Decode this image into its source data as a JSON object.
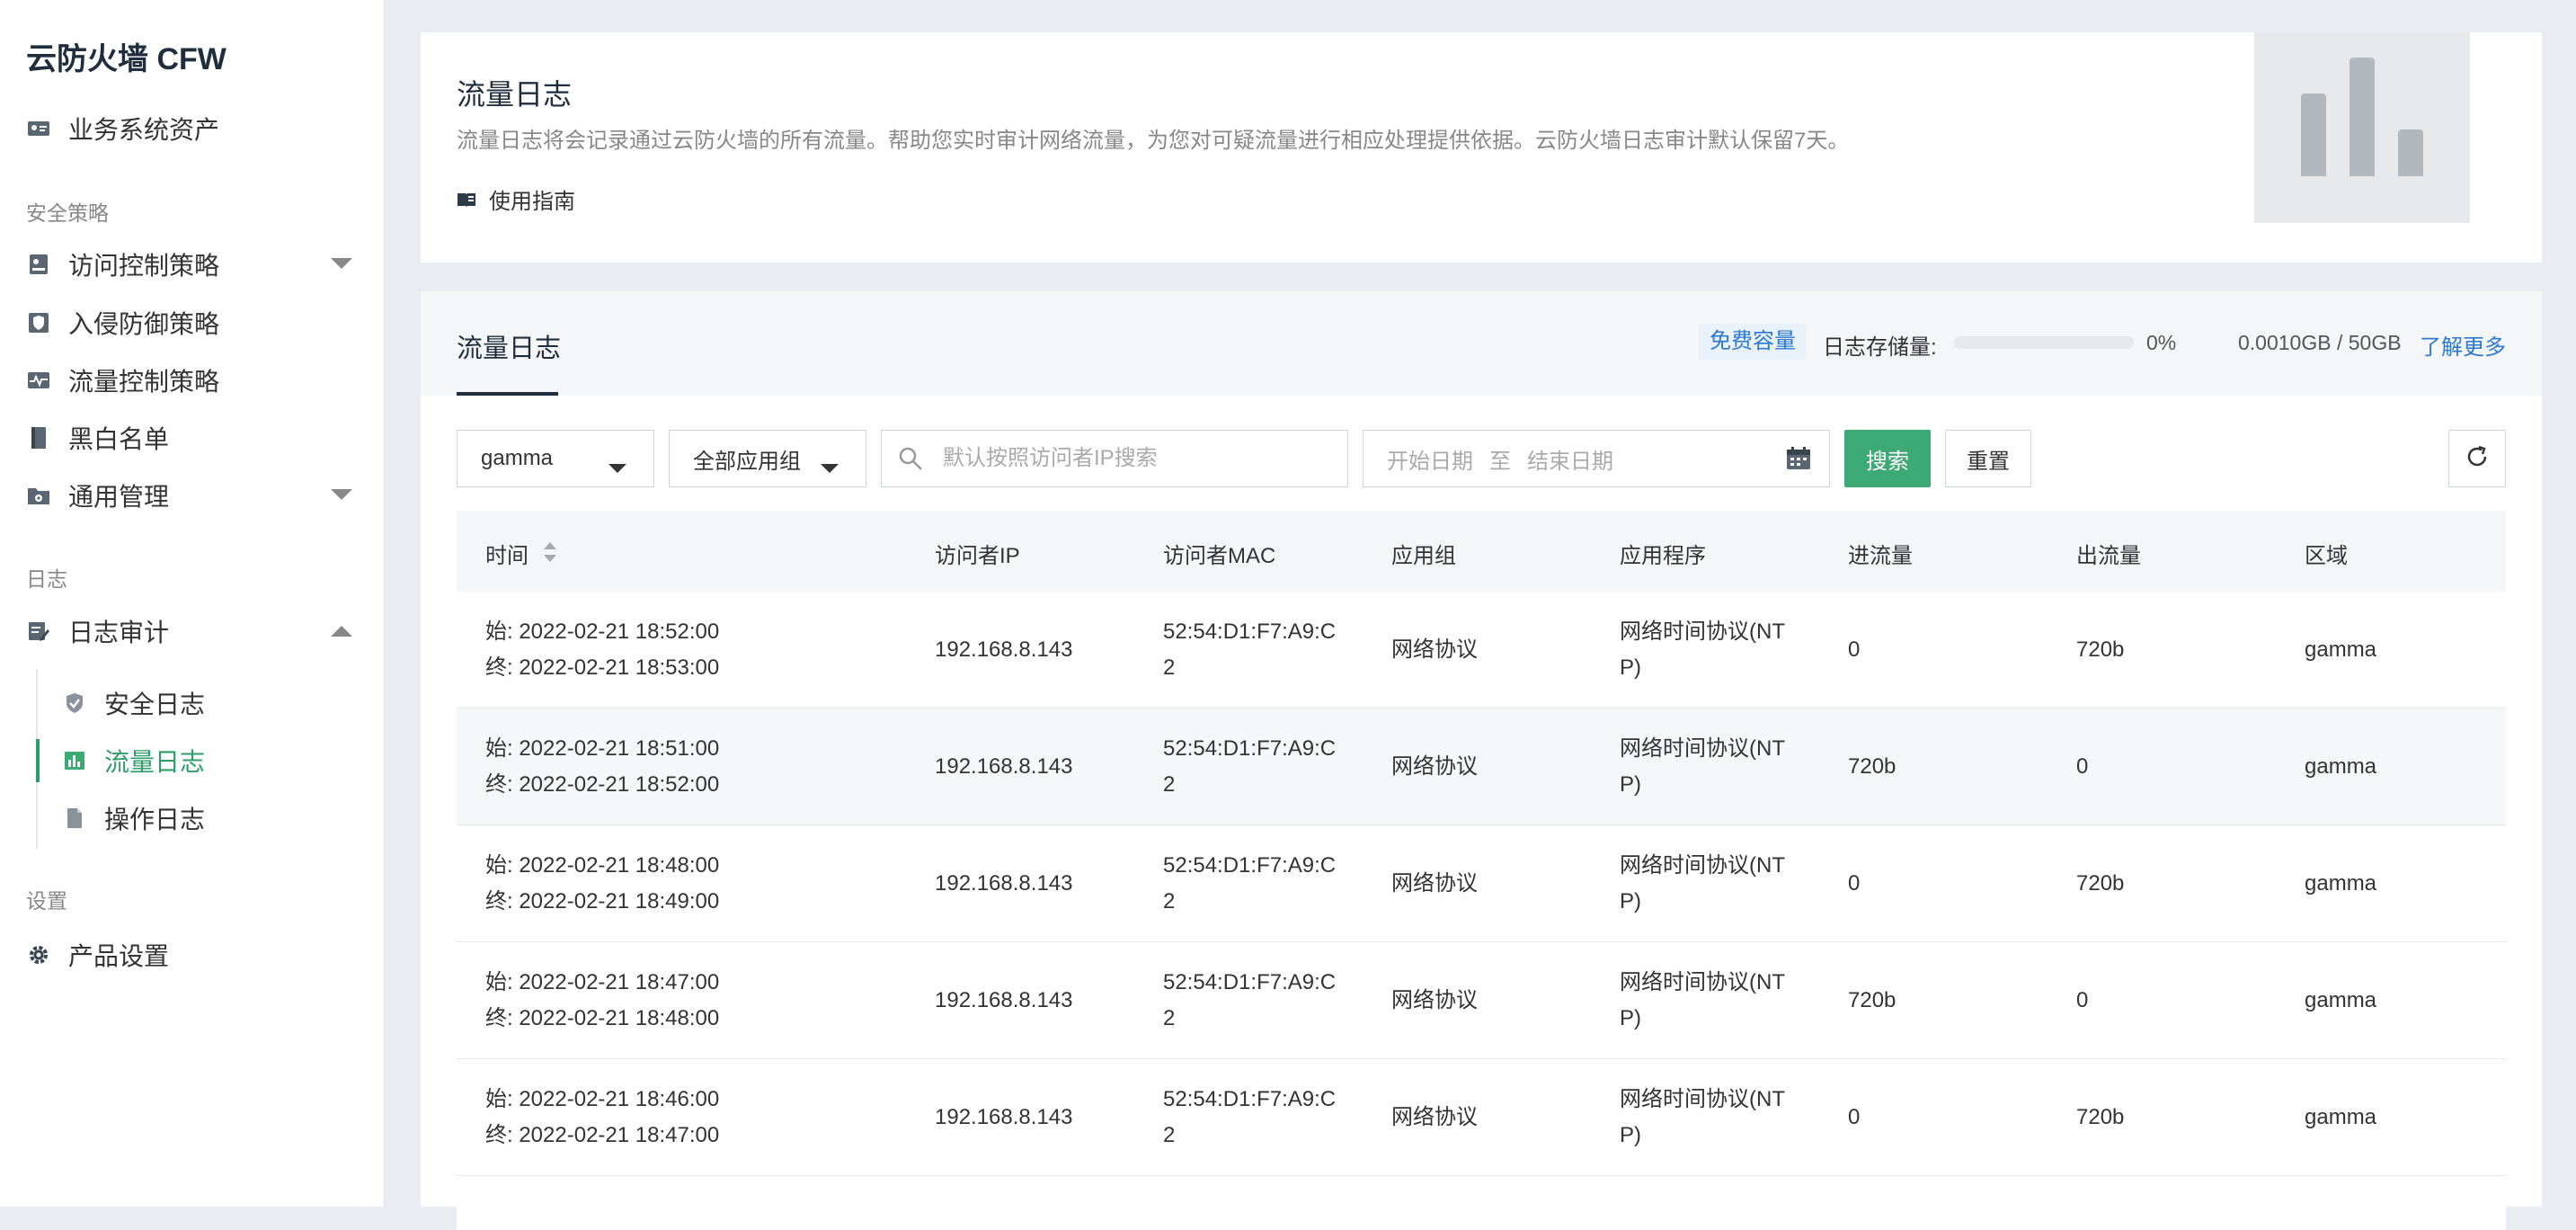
{
  "sidebar": {
    "app_title": "云防火墙 CFW",
    "assets_label": "业务系统资产",
    "section_security": "安全策略",
    "access_control": "访问控制策略",
    "intrusion_defense": "入侵防御策略",
    "traffic_control": "流量控制策略",
    "blackwhite_list": "黑白名单",
    "general_mgmt": "通用管理",
    "section_logs": "日志",
    "log_audit": "日志审计",
    "security_log": "安全日志",
    "traffic_log": "流量日志",
    "operation_log": "操作日志",
    "section_settings": "设置",
    "product_settings": "产品设置",
    "active_item": "流量日志"
  },
  "header": {
    "title": "流量日志",
    "description": "流量日志将会记录通过云防火墙的所有流量。帮助您实时审计网络流量，为您对可疑流量进行相应处理提供依据。云防火墙日志审计默认保留7天。",
    "guide_link": "使用指南"
  },
  "panel": {
    "tab_label": "流量日志",
    "quota_badge": "免费容量",
    "storage_label": "日志存储量:",
    "storage_fraction": 0,
    "storage_percent": "0%",
    "storage_used": "0.0010GB / 50GB",
    "learn_more": "了解更多"
  },
  "toolbar": {
    "region_select": "gamma",
    "app_group_select": "全部应用组",
    "search_placeholder": "默认按照访问者IP搜索",
    "date_start_placeholder": "开始日期",
    "date_separator": "至",
    "date_end_placeholder": "结束日期",
    "search_button": "搜索",
    "reset_button": "重置"
  },
  "table": {
    "columns": [
      "时间",
      "访问者IP",
      "访问者MAC",
      "应用组",
      "应用程序",
      "进流量",
      "出流量",
      "区域"
    ],
    "rows": [
      {
        "start": "始: 2022-02-21 18:52:00",
        "end": "终: 2022-02-21 18:53:00",
        "ip": "192.168.8.143",
        "mac1": "52:54:D1:F7:A9:C",
        "mac2": "2",
        "group": "网络协议",
        "app1": "网络时间协议(NT",
        "app2": "P)",
        "in": "0",
        "out": "720b",
        "region": "gamma"
      },
      {
        "start": "始: 2022-02-21 18:51:00",
        "end": "终: 2022-02-21 18:52:00",
        "ip": "192.168.8.143",
        "mac1": "52:54:D1:F7:A9:C",
        "mac2": "2",
        "group": "网络协议",
        "app1": "网络时间协议(NT",
        "app2": "P)",
        "in": "720b",
        "out": "0",
        "region": "gamma"
      },
      {
        "start": "始: 2022-02-21 18:48:00",
        "end": "终: 2022-02-21 18:49:00",
        "ip": "192.168.8.143",
        "mac1": "52:54:D1:F7:A9:C",
        "mac2": "2",
        "group": "网络协议",
        "app1": "网络时间协议(NT",
        "app2": "P)",
        "in": "0",
        "out": "720b",
        "region": "gamma"
      },
      {
        "start": "始: 2022-02-21 18:47:00",
        "end": "终: 2022-02-21 18:48:00",
        "ip": "192.168.8.143",
        "mac1": "52:54:D1:F7:A9:C",
        "mac2": "2",
        "group": "网络协议",
        "app1": "网络时间协议(NT",
        "app2": "P)",
        "in": "720b",
        "out": "0",
        "region": "gamma"
      },
      {
        "start": "始: 2022-02-21 18:46:00",
        "end": "终: 2022-02-21 18:47:00",
        "ip": "192.168.8.143",
        "mac1": "52:54:D1:F7:A9:C",
        "mac2": "2",
        "group": "网络协议",
        "app1": "网络时间协议(NT",
        "app2": "P)",
        "in": "0",
        "out": "720b",
        "region": "gamma"
      }
    ]
  },
  "colors": {
    "accent_green": "#3daa75",
    "link_blue": "#2b79d0",
    "sidebar_active": "#2e9e6b"
  }
}
